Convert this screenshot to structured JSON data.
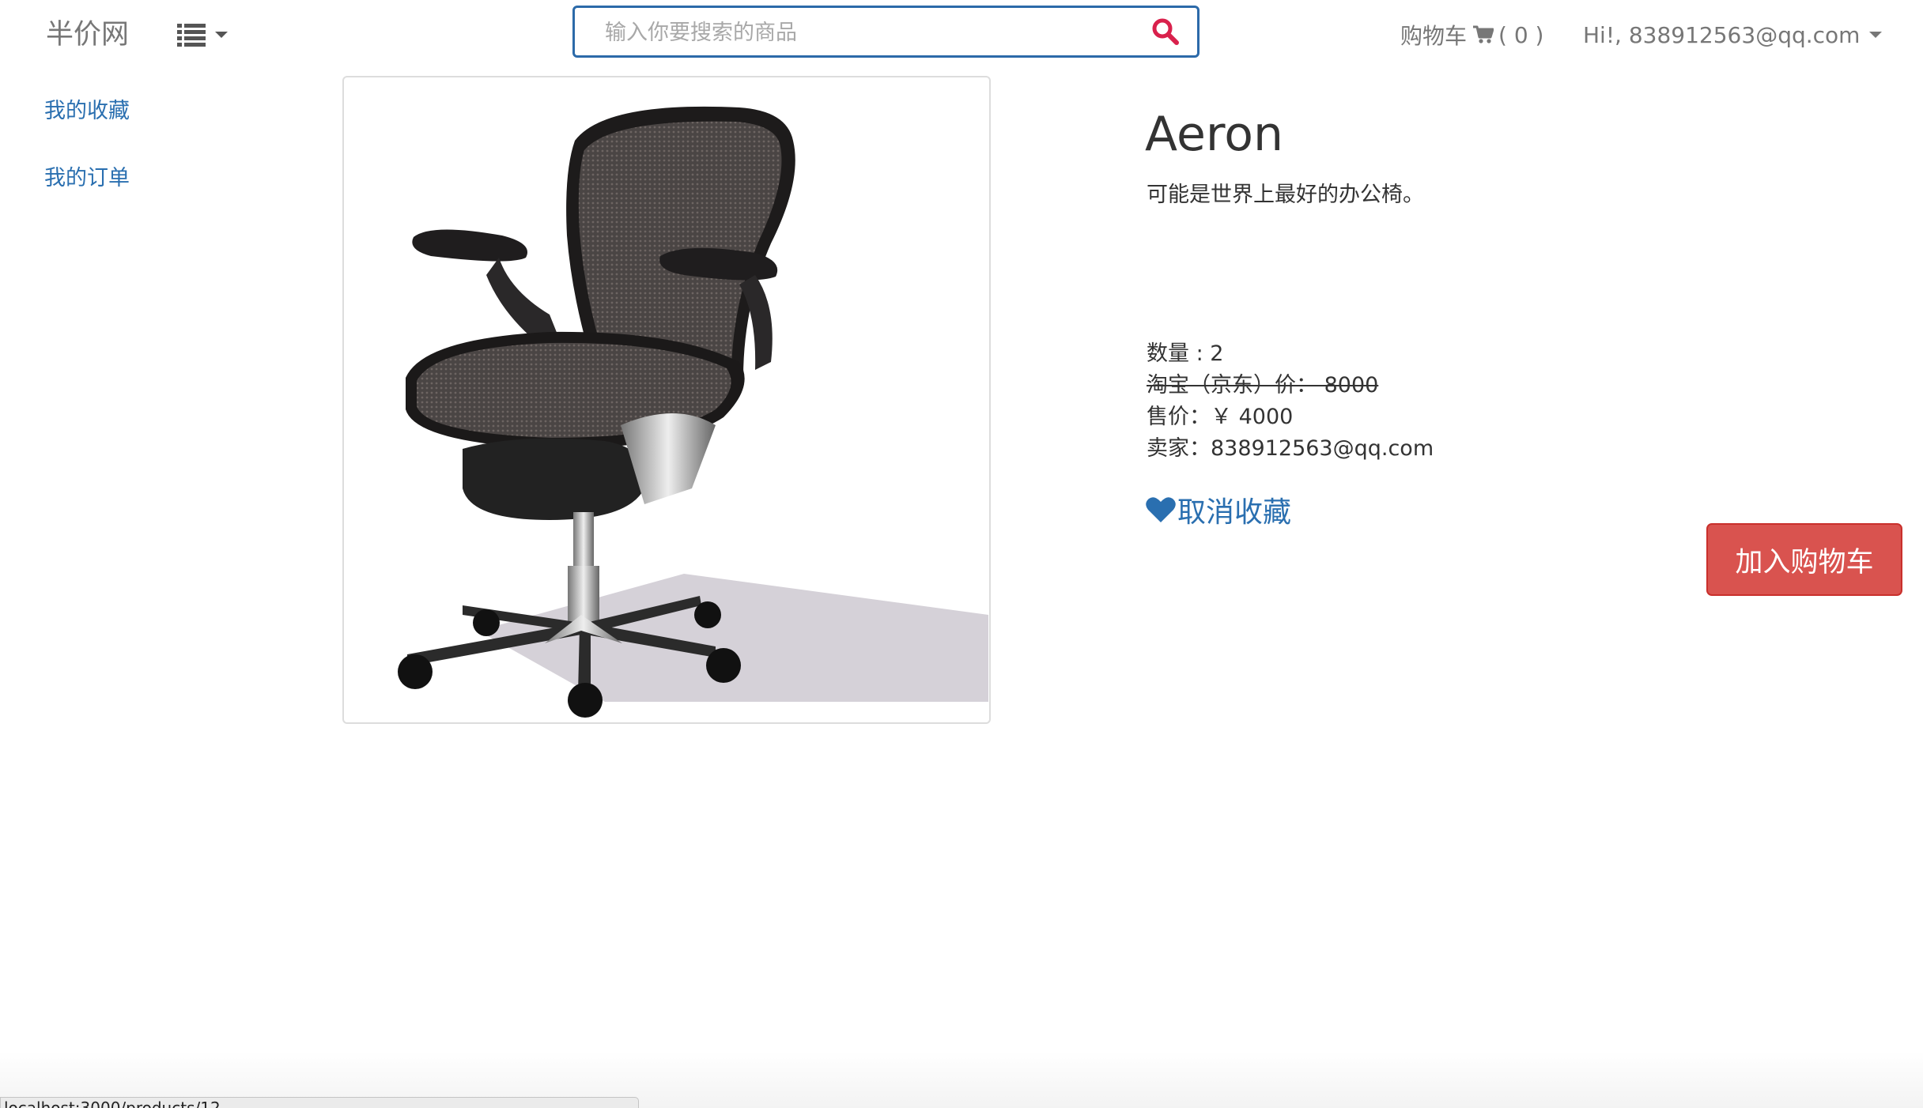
{
  "navbar": {
    "brand": "半价网",
    "search_placeholder": "输入你要搜索的商品",
    "cart_label": "购物车",
    "cart_count": "( 0 )",
    "user_greeting": "Hi!, 838912563@qq.com"
  },
  "sidebar": {
    "items": [
      {
        "label": "我的收藏"
      },
      {
        "label": "我的订单"
      }
    ]
  },
  "product": {
    "name": "Aeron",
    "description": "可能是世界上最好的办公椅。",
    "quantity_line": "数量 : 2",
    "original_price_line": "淘宝（京东）价： 8000",
    "price_line": "售价：￥ 4000",
    "seller_line": "卖家：838912563@qq.com",
    "unfavorite_label": "取消收藏",
    "add_to_cart_label": "加入购物车"
  },
  "status_bar": {
    "url": "localhost:3000/products/12"
  },
  "colors": {
    "link": "#2a6fb0",
    "danger_button": "#d9534f",
    "search_border": "#2c6aa9",
    "search_icon": "#d9214c"
  },
  "icons": [
    "list-icon",
    "search-icon",
    "cart-icon",
    "heart-icon",
    "office-chair-image"
  ]
}
